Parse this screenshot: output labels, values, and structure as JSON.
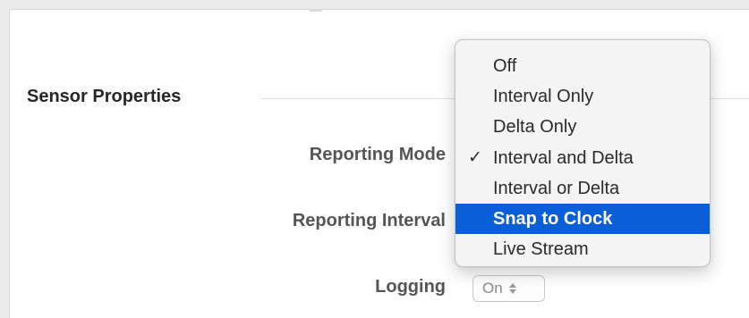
{
  "section": {
    "title": "Sensor Properties"
  },
  "rows": {
    "reporting_mode_label": "Reporting Mode",
    "reporting_interval_label": "Reporting Interval",
    "logging_label": "Logging"
  },
  "logging_select": {
    "value": "On",
    "icon": "stepper-icon"
  },
  "reporting_mode_menu": {
    "checked_item": "Interval and Delta",
    "highlighted_item": "Snap to Clock",
    "check_glyph": "✓",
    "highlight_color": "#0a5ed7",
    "items": [
      {
        "label": "Off"
      },
      {
        "label": "Interval Only"
      },
      {
        "label": "Delta Only"
      },
      {
        "label": "Interval and Delta"
      },
      {
        "label": "Interval or Delta"
      },
      {
        "label": "Snap to Clock"
      },
      {
        "label": "Live Stream"
      }
    ]
  }
}
